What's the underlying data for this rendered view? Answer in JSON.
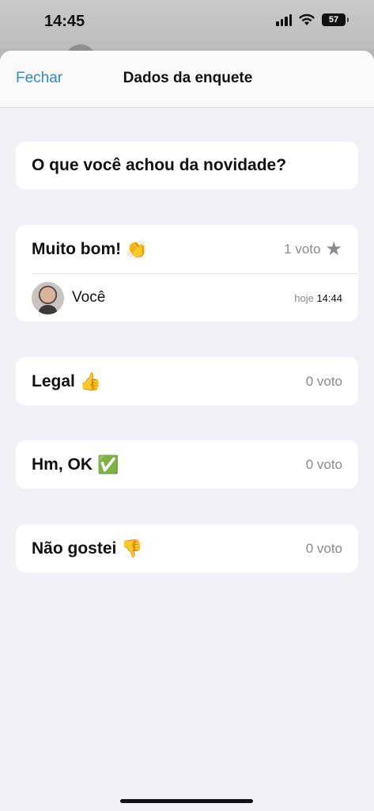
{
  "status": {
    "time": "14:45",
    "battery": "57"
  },
  "header": {
    "close_label": "Fechar",
    "title": "Dados da enquete"
  },
  "poll": {
    "question": "O que você achou da novidade?",
    "options": [
      {
        "label": "Muito bom!",
        "emoji": "👏",
        "votes": "1 voto",
        "voters": [
          {
            "name": "Você",
            "day": "hoje",
            "time": "14:44"
          }
        ]
      },
      {
        "label": "Legal",
        "emoji": "👍",
        "votes": "0 voto"
      },
      {
        "label": "Hm, OK",
        "emoji": "✅",
        "votes": "0 voto"
      },
      {
        "label": "Não gostei",
        "emoji": "👎",
        "votes": "0 voto"
      }
    ]
  }
}
